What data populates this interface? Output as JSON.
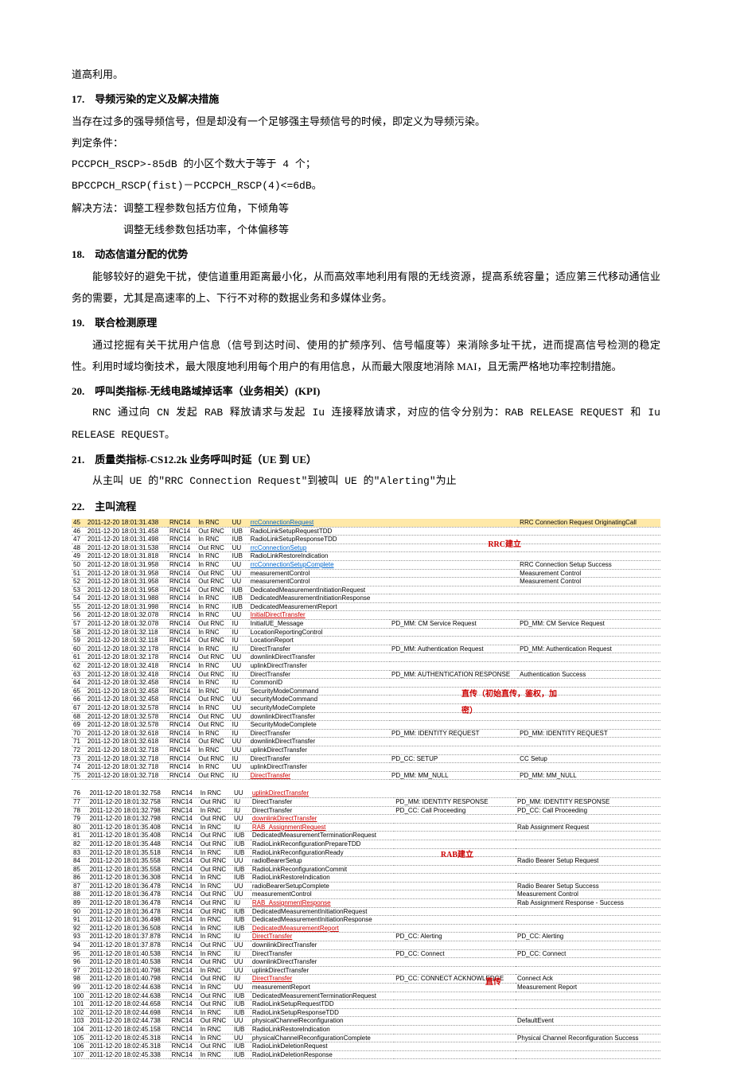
{
  "intro": {
    "line1": "道高利用。"
  },
  "s17": {
    "title": "17.　导频污染的定义及解决措施",
    "p1": "当存在过多的强导频信号，但是却没有一个足够强主导频信号的时候，即定义为导频污染。",
    "p2": "判定条件：",
    "p3": "PCCPCH_RSCP>-85dB 的小区个数大于等于 4 个；",
    "p4": "BPCCPCH_RSCP(fist)－PCCPCH_RSCP(4)<=6dB。",
    "p5": "解决方法：调整工程参数包括方位角，下倾角等",
    "p6": "调整无线参数包括功率，个体偏移等"
  },
  "s18": {
    "title": "18.　动态信道分配的优势",
    "p1": "能够较好的避免干扰，使信道重用距离最小化，从而高效率地利用有限的无线资源，提高系统容量；适应第三代移动通信业务的需要，尤其是高速率的上、下行不对称的数据业务和多媒体业务。"
  },
  "s19": {
    "title": "19.　联合检测原理",
    "p1": "通过挖掘有关干扰用户信息（信号到达时间、使用的扩频序列、信号幅度等）来消除多址干扰，进而提高信号检测的稳定性。利用时域均衡技术，最大限度地利用每个用户的有用信息，从而最大限度地消除 MAI，且无需严格地功率控制措施。"
  },
  "s20": {
    "title": "20.　呼叫类指标-无线电路域掉话率（业务相关）(KPI)",
    "p1": "RNC 通过向 CN 发起 RAB 释放请求与发起 Iu 连接释放请求，对应的信令分别为：RAB RELEASE REQUEST 和 Iu RELEASE REQUEST。"
  },
  "s21": {
    "title": "21.　质量类指标-CS12.2k 业务呼叫时延（UE 到 UE）",
    "p1": "从主叫 UE 的\"RRC Connection Request\"到被叫 UE 的\"Alerting\"为止"
  },
  "s22": {
    "title": "22.　主叫流程"
  },
  "annot": {
    "rrc": "RRC建立",
    "dt": "直传（初始直传，鉴权，加密）",
    "rab": "RAB建立",
    "dt2": "直传"
  },
  "rowsA": [
    {
      "n": "45",
      "t": "2011-12-20 18:01:31.438",
      "r": "RNC14",
      "d": "In RNC",
      "i": "UU",
      "m": "rrcConnectionRequest",
      "c6": "",
      "c7": "RRC Connection Request OriginatingCall",
      "hi": true,
      "ml": "blue"
    },
    {
      "n": "46",
      "t": "2011-12-20 18:01:31.458",
      "r": "RNC14",
      "d": "Out RNC",
      "i": "IUB",
      "m": "RadioLinkSetupRequestTDD",
      "c6": "",
      "c7": ""
    },
    {
      "n": "47",
      "t": "2011-12-20 18:01:31.498",
      "r": "RNC14",
      "d": "In RNC",
      "i": "IUB",
      "m": "RadioLinkSetupResponseTDD",
      "c6": "",
      "c7": ""
    },
    {
      "n": "48",
      "t": "2011-12-20 18:01:31.538",
      "r": "RNC14",
      "d": "Out RNC",
      "i": "UU",
      "m": "rrcConnectionSetup",
      "c6": "",
      "c7": "",
      "ml": "blue"
    },
    {
      "n": "49",
      "t": "2011-12-20 18:01:31.818",
      "r": "RNC14",
      "d": "In RNC",
      "i": "IUB",
      "m": "RadioLinkRestoreIndication",
      "c6": "",
      "c7": ""
    },
    {
      "n": "50",
      "t": "2011-12-20 18:01:31.958",
      "r": "RNC14",
      "d": "In RNC",
      "i": "UU",
      "m": "rrcConnectionSetupComplete",
      "c6": "",
      "c7": "RRC Connection Setup Success",
      "ml": "blue"
    },
    {
      "n": "51",
      "t": "2011-12-20 18:01:31.958",
      "r": "RNC14",
      "d": "Out RNC",
      "i": "UU",
      "m": "measurementControl",
      "c6": "",
      "c7": "Measurement Control"
    },
    {
      "n": "52",
      "t": "2011-12-20 18:01:31.958",
      "r": "RNC14",
      "d": "Out RNC",
      "i": "UU",
      "m": "measurementControl",
      "c6": "",
      "c7": "Measurement Control"
    },
    {
      "n": "53",
      "t": "2011-12-20 18:01:31.958",
      "r": "RNC14",
      "d": "Out RNC",
      "i": "IUB",
      "m": "DedicatedMeasurementInitiationRequest",
      "c6": "",
      "c7": ""
    },
    {
      "n": "54",
      "t": "2011-12-20 18:01:31.988",
      "r": "RNC14",
      "d": "In RNC",
      "i": "IUB",
      "m": "DedicatedMeasurementInitiationResponse",
      "c6": "",
      "c7": ""
    },
    {
      "n": "55",
      "t": "2011-12-20 18:01:31.998",
      "r": "RNC14",
      "d": "In RNC",
      "i": "IUB",
      "m": "DedicatedMeasurementReport",
      "c6": "",
      "c7": ""
    },
    {
      "n": "56",
      "t": "2011-12-20 18:01:32.078",
      "r": "RNC14",
      "d": "In RNC",
      "i": "UU",
      "m": "InitialDirectTransfer",
      "c6": "",
      "c7": "",
      "ml": "red"
    },
    {
      "n": "57",
      "t": "2011-12-20 18:01:32.078",
      "r": "RNC14",
      "d": "Out RNC",
      "i": "IU",
      "m": "InitialUE_Message",
      "c6": "PD_MM: CM Service Request",
      "c7": "PD_MM: CM Service Request"
    },
    {
      "n": "58",
      "t": "2011-12-20 18:01:32.118",
      "r": "RNC14",
      "d": "In RNC",
      "i": "IU",
      "m": "LocationReportingControl",
      "c6": "",
      "c7": ""
    },
    {
      "n": "59",
      "t": "2011-12-20 18:01:32.118",
      "r": "RNC14",
      "d": "Out RNC",
      "i": "IU",
      "m": "LocationReport",
      "c6": "",
      "c7": ""
    },
    {
      "n": "60",
      "t": "2011-12-20 18:01:32.178",
      "r": "RNC14",
      "d": "In RNC",
      "i": "IU",
      "m": "DirectTransfer",
      "c6": "PD_MM: Authentication Request",
      "c7": "PD_MM: Authentication Request"
    },
    {
      "n": "61",
      "t": "2011-12-20 18:01:32.178",
      "r": "RNC14",
      "d": "Out RNC",
      "i": "UU",
      "m": "downlinkDirectTransfer",
      "c6": "",
      "c7": ""
    },
    {
      "n": "62",
      "t": "2011-12-20 18:01:32.418",
      "r": "RNC14",
      "d": "In RNC",
      "i": "UU",
      "m": "uplinkDirectTransfer",
      "c6": "",
      "c7": ""
    },
    {
      "n": "63",
      "t": "2011-12-20 18:01:32.418",
      "r": "RNC14",
      "d": "Out RNC",
      "i": "IU",
      "m": "DirectTransfer",
      "c6": "PD_MM: AUTHENTICATION RESPONSE",
      "c7": "Authentication Success"
    },
    {
      "n": "64",
      "t": "2011-12-20 18:01:32.458",
      "r": "RNC14",
      "d": "In RNC",
      "i": "IU",
      "m": "CommonID",
      "c6": "",
      "c7": ""
    },
    {
      "n": "65",
      "t": "2011-12-20 18:01:32.458",
      "r": "RNC14",
      "d": "In RNC",
      "i": "IU",
      "m": "SecurityModeCommand",
      "c6": "",
      "c7": ""
    },
    {
      "n": "66",
      "t": "2011-12-20 18:01:32.458",
      "r": "RNC14",
      "d": "Out RNC",
      "i": "UU",
      "m": "securityModeCommand",
      "c6": "",
      "c7": ""
    },
    {
      "n": "67",
      "t": "2011-12-20 18:01:32.578",
      "r": "RNC14",
      "d": "In RNC",
      "i": "UU",
      "m": "securityModeComplete",
      "c6": "",
      "c7": ""
    },
    {
      "n": "68",
      "t": "2011-12-20 18:01:32.578",
      "r": "RNC14",
      "d": "Out RNC",
      "i": "UU",
      "m": "downlinkDirectTransfer",
      "c6": "",
      "c7": ""
    },
    {
      "n": "69",
      "t": "2011-12-20 18:01:32.578",
      "r": "RNC14",
      "d": "Out RNC",
      "i": "IU",
      "m": "SecurityModeComplete",
      "c6": "",
      "c7": ""
    },
    {
      "n": "70",
      "t": "2011-12-20 18:01:32.618",
      "r": "RNC14",
      "d": "In RNC",
      "i": "IU",
      "m": "DirectTransfer",
      "c6": "PD_MM: IDENTITY REQUEST",
      "c7": "PD_MM: IDENTITY REQUEST"
    },
    {
      "n": "71",
      "t": "2011-12-20 18:01:32.618",
      "r": "RNC14",
      "d": "Out RNC",
      "i": "UU",
      "m": "downlinkDirectTransfer",
      "c6": "",
      "c7": ""
    },
    {
      "n": "72",
      "t": "2011-12-20 18:01:32.718",
      "r": "RNC14",
      "d": "In RNC",
      "i": "UU",
      "m": "uplinkDirectTransfer",
      "c6": "",
      "c7": ""
    },
    {
      "n": "73",
      "t": "2011-12-20 18:01:32.718",
      "r": "RNC14",
      "d": "Out RNC",
      "i": "IU",
      "m": "DirectTransfer",
      "c6": "PD_CC: SETUP",
      "c7": "CC Setup"
    },
    {
      "n": "74",
      "t": "2011-12-20 18:01:32.718",
      "r": "RNC14",
      "d": "In RNC",
      "i": "UU",
      "m": "uplinkDirectTransfer",
      "c6": "",
      "c7": ""
    },
    {
      "n": "75",
      "t": "2011-12-20 18:01:32.718",
      "r": "RNC14",
      "d": "Out RNC",
      "i": "IU",
      "m": "DirectTransfer",
      "c6": "PD_MM: MM_NULL",
      "c7": "PD_MM: MM_NULL",
      "ml": "red"
    }
  ],
  "rowsB": [
    {
      "n": "76",
      "t": "2011-12-20 18:01:32.758",
      "r": "RNC14",
      "d": "In RNC",
      "i": "UU",
      "m": "uplinkDirectTransfer",
      "c6": "",
      "c7": "",
      "ml": "red"
    },
    {
      "n": "77",
      "t": "2011-12-20 18:01:32.758",
      "r": "RNC14",
      "d": "Out RNC",
      "i": "IU",
      "m": "DirectTransfer",
      "c6": "PD_MM: IDENTITY RESPONSE",
      "c7": "PD_MM: IDENTITY RESPONSE"
    },
    {
      "n": "78",
      "t": "2011-12-20 18:01:32.798",
      "r": "RNC14",
      "d": "In RNC",
      "i": "IU",
      "m": "DirectTransfer",
      "c6": "PD_CC: Call Proceeding",
      "c7": "PD_CC: Call Proceeding"
    },
    {
      "n": "79",
      "t": "2011-12-20 18:01:32.798",
      "r": "RNC14",
      "d": "Out RNC",
      "i": "UU",
      "m": "downlinkDirectTransfer",
      "c6": "",
      "c7": "",
      "ml": "red"
    },
    {
      "n": "80",
      "t": "2011-12-20 18:01:35.408",
      "r": "RNC14",
      "d": "In RNC",
      "i": "IU",
      "m": "RAB_AssignmentRequest",
      "c6": "",
      "c7": "Rab Assignment Request",
      "ml": "red"
    },
    {
      "n": "81",
      "t": "2011-12-20 18:01:35.408",
      "r": "RNC14",
      "d": "Out RNC",
      "i": "IUB",
      "m": "DedicatedMeasurementTerminationRequest",
      "c6": "",
      "c7": ""
    },
    {
      "n": "82",
      "t": "2011-12-20 18:01:35.448",
      "r": "RNC14",
      "d": "Out RNC",
      "i": "IUB",
      "m": "RadioLinkReconfigurationPrepareTDD",
      "c6": "",
      "c7": ""
    },
    {
      "n": "83",
      "t": "2011-12-20 18:01:35.518",
      "r": "RNC14",
      "d": "In RNC",
      "i": "IUB",
      "m": "RadioLinkReconfigurationReady",
      "c6": "",
      "c7": ""
    },
    {
      "n": "84",
      "t": "2011-12-20 18:01:35.558",
      "r": "RNC14",
      "d": "Out RNC",
      "i": "UU",
      "m": "radioBearerSetup",
      "c6": "",
      "c7": "Radio Bearer Setup Request"
    },
    {
      "n": "85",
      "t": "2011-12-20 18:01:35.558",
      "r": "RNC14",
      "d": "Out RNC",
      "i": "IUB",
      "m": "RadioLinkReconfigurationCommit",
      "c6": "",
      "c7": ""
    },
    {
      "n": "86",
      "t": "2011-12-20 18:01:36.308",
      "r": "RNC14",
      "d": "In RNC",
      "i": "IUB",
      "m": "RadioLinkRestoreIndication",
      "c6": "",
      "c7": ""
    },
    {
      "n": "87",
      "t": "2011-12-20 18:01:36.478",
      "r": "RNC14",
      "d": "In RNC",
      "i": "UU",
      "m": "radioBearerSetupComplete",
      "c6": "",
      "c7": "Radio Bearer Setup Success"
    },
    {
      "n": "88",
      "t": "2011-12-20 18:01:36.478",
      "r": "RNC14",
      "d": "Out RNC",
      "i": "UU",
      "m": "measurementControl",
      "c6": "",
      "c7": "Measurement Control"
    },
    {
      "n": "89",
      "t": "2011-12-20 18:01:36.478",
      "r": "RNC14",
      "d": "Out RNC",
      "i": "IU",
      "m": "RAB_AssignmentResponse",
      "c6": "",
      "c7": "Rab Assignment Response - Success",
      "ml": "red"
    },
    {
      "n": "90",
      "t": "2011-12-20 18:01:36.478",
      "r": "RNC14",
      "d": "Out RNC",
      "i": "IUB",
      "m": "DedicatedMeasurementInitiationRequest",
      "c6": "",
      "c7": ""
    },
    {
      "n": "91",
      "t": "2011-12-20 18:01:36.498",
      "r": "RNC14",
      "d": "In RNC",
      "i": "IUB",
      "m": "DedicatedMeasurementInitiationResponse",
      "c6": "",
      "c7": ""
    },
    {
      "n": "92",
      "t": "2011-12-20 18:01:36.508",
      "r": "RNC14",
      "d": "In RNC",
      "i": "IUB",
      "m": "DedicatedMeasurementReport",
      "c6": "",
      "c7": "",
      "ml": "red"
    },
    {
      "n": "93",
      "t": "2011-12-20 18:01:37.878",
      "r": "RNC14",
      "d": "In RNC",
      "i": "IU",
      "m": "DirectTransfer",
      "c6": "PD_CC: Alerting",
      "c7": "PD_CC: Alerting",
      "ml": "red"
    },
    {
      "n": "94",
      "t": "2011-12-20 18:01:37.878",
      "r": "RNC14",
      "d": "Out RNC",
      "i": "UU",
      "m": "downlinkDirectTransfer",
      "c6": "",
      "c7": ""
    },
    {
      "n": "95",
      "t": "2011-12-20 18:01:40.538",
      "r": "RNC14",
      "d": "In RNC",
      "i": "IU",
      "m": "DirectTransfer",
      "c6": "PD_CC: Connect",
      "c7": "PD_CC: Connect"
    },
    {
      "n": "96",
      "t": "2011-12-20 18:01:40.538",
      "r": "RNC14",
      "d": "Out RNC",
      "i": "UU",
      "m": "downlinkDirectTransfer",
      "c6": "",
      "c7": ""
    },
    {
      "n": "97",
      "t": "2011-12-20 18:01:40.798",
      "r": "RNC14",
      "d": "In RNC",
      "i": "UU",
      "m": "uplinkDirectTransfer",
      "c6": "",
      "c7": ""
    },
    {
      "n": "98",
      "t": "2011-12-20 18:01:40.798",
      "r": "RNC14",
      "d": "Out RNC",
      "i": "IU",
      "m": "DirectTransfer",
      "c6": "PD_CC: CONNECT ACKNOWLEDGE",
      "c7": "Connect Ack",
      "ml": "red"
    },
    {
      "n": "99",
      "t": "2011-12-20 18:02:44.638",
      "r": "RNC14",
      "d": "In RNC",
      "i": "UU",
      "m": "measurementReport",
      "c6": "",
      "c7": "Measurement Report"
    },
    {
      "n": "100",
      "t": "2011-12-20 18:02:44.638",
      "r": "RNC14",
      "d": "Out RNC",
      "i": "IUB",
      "m": "DedicatedMeasurementTerminationRequest",
      "c6": "",
      "c7": ""
    },
    {
      "n": "101",
      "t": "2011-12-20 18:02:44.658",
      "r": "RNC14",
      "d": "Out RNC",
      "i": "IUB",
      "m": "RadioLinkSetupRequestTDD",
      "c6": "",
      "c7": ""
    },
    {
      "n": "102",
      "t": "2011-12-20 18:02:44.698",
      "r": "RNC14",
      "d": "In RNC",
      "i": "IUB",
      "m": "RadioLinkSetupResponseTDD",
      "c6": "",
      "c7": ""
    },
    {
      "n": "103",
      "t": "2011-12-20 18:02:44.738",
      "r": "RNC14",
      "d": "Out RNC",
      "i": "UU",
      "m": "physicalChannelReconfiguration",
      "c6": "",
      "c7": "DefaultEvent"
    },
    {
      "n": "104",
      "t": "2011-12-20 18:02:45.158",
      "r": "RNC14",
      "d": "In RNC",
      "i": "IUB",
      "m": "RadioLinkRestoreIndication",
      "c6": "",
      "c7": ""
    },
    {
      "n": "105",
      "t": "2011-12-20 18:02:45.318",
      "r": "RNC14",
      "d": "In RNC",
      "i": "UU",
      "m": "physicalChannelReconfigurationComplete",
      "c6": "",
      "c7": "Physical Channel Reconfiguration Success"
    },
    {
      "n": "106",
      "t": "2011-12-20 18:02:45.318",
      "r": "RNC14",
      "d": "Out RNC",
      "i": "IUB",
      "m": "RadioLinkDeletionRequest",
      "c6": "",
      "c7": ""
    },
    {
      "n": "107",
      "t": "2011-12-20 18:02:45.338",
      "r": "RNC14",
      "d": "In RNC",
      "i": "IUB",
      "m": "RadioLinkDeletionResponse",
      "c6": "",
      "c7": ""
    }
  ]
}
